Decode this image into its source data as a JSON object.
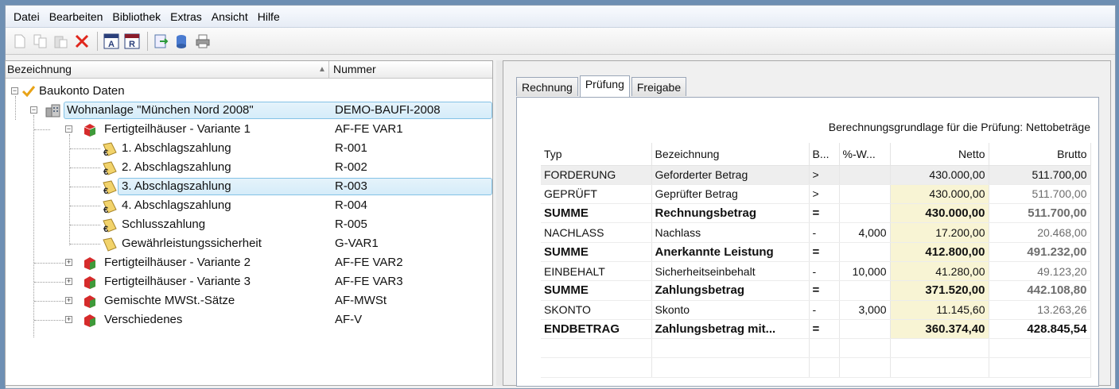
{
  "menu": [
    "Datei",
    "Bearbeiten",
    "Bibliothek",
    "Extras",
    "Ansicht",
    "Hilfe"
  ],
  "toolbar_icons": [
    "new-document-icon",
    "copy-icon",
    "paste-icon",
    "delete-icon",
    "report-a-icon",
    "report-r-icon",
    "export-icon",
    "database-icon",
    "print-icon"
  ],
  "tree": {
    "columns": {
      "name": "Bezeichnung",
      "number": "Nummer"
    },
    "rows": [
      {
        "label": "Baukonto Daten",
        "number": ""
      },
      {
        "label": "Wohnanlage \"München Nord 2008\"",
        "number": "DEMO-BAUFI-2008"
      },
      {
        "label": "Fertigteilhäuser - Variante 1",
        "number": "AF-FE VAR1"
      },
      {
        "label": "1. Abschlagszahlung",
        "number": "R-001"
      },
      {
        "label": "2. Abschlagszahlung",
        "number": "R-002"
      },
      {
        "label": "3. Abschlagszahlung",
        "number": "R-003"
      },
      {
        "label": "4. Abschlagszahlung",
        "number": "R-004"
      },
      {
        "label": "Schlusszahlung",
        "number": "R-005"
      },
      {
        "label": "Gewährleistungssicherheit",
        "number": "G-VAR1"
      },
      {
        "label": "Fertigteilhäuser - Variante 2",
        "number": "AF-FE VAR2"
      },
      {
        "label": "Fertigteilhäuser - Variante 3",
        "number": "AF-FE VAR3"
      },
      {
        "label": "Gemischte MWSt.-Sätze",
        "number": "AF-MWSt"
      },
      {
        "label": "Verschiedenes",
        "number": "AF-V"
      }
    ]
  },
  "tabs": [
    "Rechnung",
    "Prüfung",
    "Freigabe"
  ],
  "basis_text": "Berechnungsgrundlage für die Prüfung: Nettobeträge",
  "grid": {
    "headers": [
      "Typ",
      "Bezeichnung",
      "B...",
      "%-W...",
      "Netto",
      "Brutto"
    ],
    "rows": [
      {
        "typ": "FORDERUNG",
        "bez": "Geforderter Betrag",
        "b": ">",
        "pw": "",
        "netto": "430.000,00",
        "brutto": "511.700,00"
      },
      {
        "typ": "GEPRÜFT",
        "bez": "Geprüfter Betrag",
        "b": ">",
        "pw": "",
        "netto": "430.000,00",
        "brutto": "511.700,00"
      },
      {
        "typ": "SUMME",
        "bez": "Rechnungsbetrag",
        "b": "=",
        "pw": "",
        "netto": "430.000,00",
        "brutto": "511.700,00"
      },
      {
        "typ": "NACHLASS",
        "bez": "Nachlass",
        "b": "-",
        "pw": "4,000",
        "netto": "17.200,00",
        "brutto": "20.468,00"
      },
      {
        "typ": "SUMME",
        "bez": "Anerkannte Leistung",
        "b": "=",
        "pw": "",
        "netto": "412.800,00",
        "brutto": "491.232,00"
      },
      {
        "typ": "EINBEHALT",
        "bez": "Sicherheitseinbehalt",
        "b": "-",
        "pw": "10,000",
        "netto": "41.280,00",
        "brutto": "49.123,20"
      },
      {
        "typ": "SUMME",
        "bez": "Zahlungsbetrag",
        "b": "=",
        "pw": "",
        "netto": "371.520,00",
        "brutto": "442.108,80"
      },
      {
        "typ": "SKONTO",
        "bez": "Skonto",
        "b": "-",
        "pw": "3,000",
        "netto": "11.145,60",
        "brutto": "13.263,26"
      },
      {
        "typ": "ENDBETRAG",
        "bez": "Zahlungsbetrag mit...",
        "b": "=",
        "pw": "",
        "netto": "360.374,40",
        "brutto": "428.845,54"
      }
    ]
  }
}
